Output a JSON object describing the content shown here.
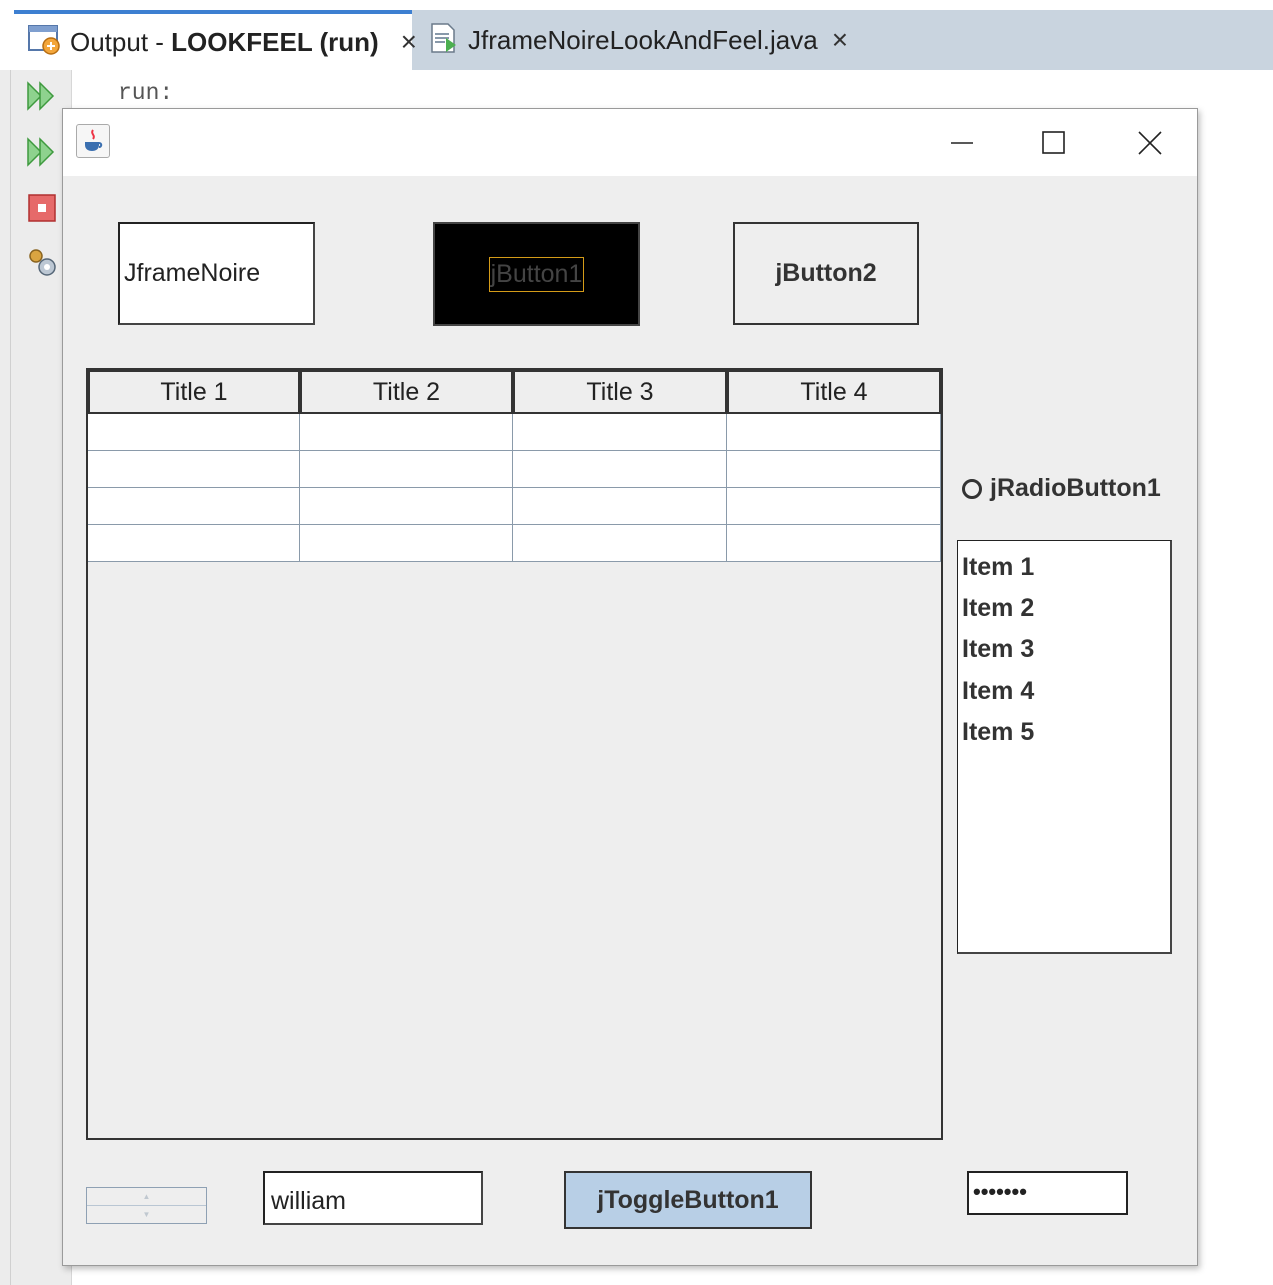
{
  "ide": {
    "tabs": [
      {
        "prefix": "Output - ",
        "bold": "LOOKFEEL (run)",
        "close": "×"
      },
      {
        "label": "JframeNoireLookAndFeel.java",
        "close": "×"
      }
    ],
    "console_text": "run:",
    "gutter_icons": [
      "rerun-icon",
      "rerun-with-options-icon",
      "stop-icon",
      "settings-icon"
    ]
  },
  "window": {
    "icon": "java-icon",
    "controls": [
      "minimize",
      "maximize",
      "close"
    ]
  },
  "buttons": {
    "jframenoire": "JframeNoire",
    "jbutton1": "jButton1",
    "jbutton2": "jButton2"
  },
  "table": {
    "columns": [
      "Title 1",
      "Title 2",
      "Title 3",
      "Title 4"
    ],
    "rows": [
      [
        "",
        "",
        "",
        ""
      ],
      [
        "",
        "",
        "",
        ""
      ],
      [
        "",
        "",
        "",
        ""
      ],
      [
        "",
        "",
        "",
        ""
      ]
    ]
  },
  "radio": {
    "label": "jRadioButton1",
    "selected": false
  },
  "list": {
    "items": [
      "Item 1",
      "Item 2",
      "Item 3",
      "Item 4",
      "Item 5"
    ]
  },
  "textfield": {
    "value": "william"
  },
  "toggle": {
    "label": "jToggleButton1",
    "pressed": true
  },
  "password": {
    "value": "•••••••"
  },
  "colors": {
    "toggle_bg": "#b8cfe6",
    "jbutton1_bg": "#000000",
    "focus_border": "#d49b18",
    "tab_accent": "#3d7fd1"
  }
}
